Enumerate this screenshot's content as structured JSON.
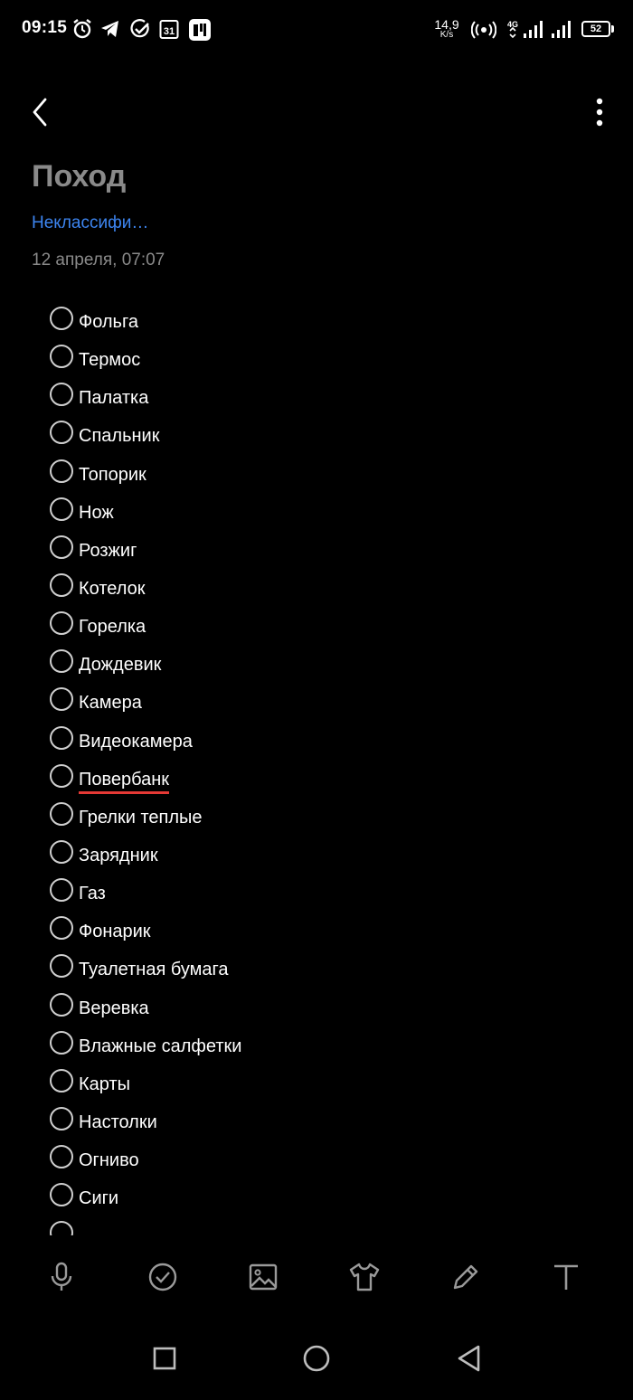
{
  "status_bar": {
    "time": "09:15",
    "calendar_day": "31",
    "net_speed_value": "14,9",
    "net_speed_unit": "K/s",
    "network_type": "4G",
    "battery": "52"
  },
  "note": {
    "title": "Поход",
    "category": "Неклассифи…",
    "date": "12 апреля, 07:07"
  },
  "checklist": [
    {
      "text": "Фольга",
      "checked": false
    },
    {
      "text": "Термос",
      "checked": false
    },
    {
      "text": "Палатка",
      "checked": false
    },
    {
      "text": "Спальник",
      "checked": false
    },
    {
      "text": "Топорик",
      "checked": false
    },
    {
      "text": "Нож",
      "checked": false
    },
    {
      "text": "Розжиг",
      "checked": false
    },
    {
      "text": "Котелок",
      "checked": false
    },
    {
      "text": "Горелка",
      "checked": false
    },
    {
      "text": "Дождевик",
      "checked": false
    },
    {
      "text": "Камера",
      "checked": false
    },
    {
      "text": "Видеокамера",
      "checked": false
    },
    {
      "text": "Повербанк",
      "checked": false,
      "spellcheck_underline": true
    },
    {
      "text": "Грелки теплые",
      "checked": false
    },
    {
      "text": "Зарядник",
      "checked": false
    },
    {
      "text": "Газ",
      "checked": false
    },
    {
      "text": "Фонарик",
      "checked": false
    },
    {
      "text": "Туалетная бумага",
      "checked": false
    },
    {
      "text": "Веревка",
      "checked": false
    },
    {
      "text": "Влажные салфетки",
      "checked": false
    },
    {
      "text": "Карты",
      "checked": false
    },
    {
      "text": "Настолки",
      "checked": false
    },
    {
      "text": "Огниво",
      "checked": false
    },
    {
      "text": "Сиги",
      "checked": false
    },
    {
      "text": "",
      "checked": false
    }
  ],
  "toolbar": [
    {
      "icon": "microphone-icon",
      "name": "voice-input-button"
    },
    {
      "icon": "check-circle-icon",
      "name": "checklist-button"
    },
    {
      "icon": "image-icon",
      "name": "insert-image-button"
    },
    {
      "icon": "shirt-icon",
      "name": "theme-button"
    },
    {
      "icon": "pencil-icon",
      "name": "handwriting-button"
    },
    {
      "icon": "text-format-icon",
      "name": "text-format-button"
    }
  ],
  "colors": {
    "background": "#000000",
    "accent": "#3d85f0",
    "muted_text": "#8a8a8a",
    "spell_underline": "#e53935"
  }
}
